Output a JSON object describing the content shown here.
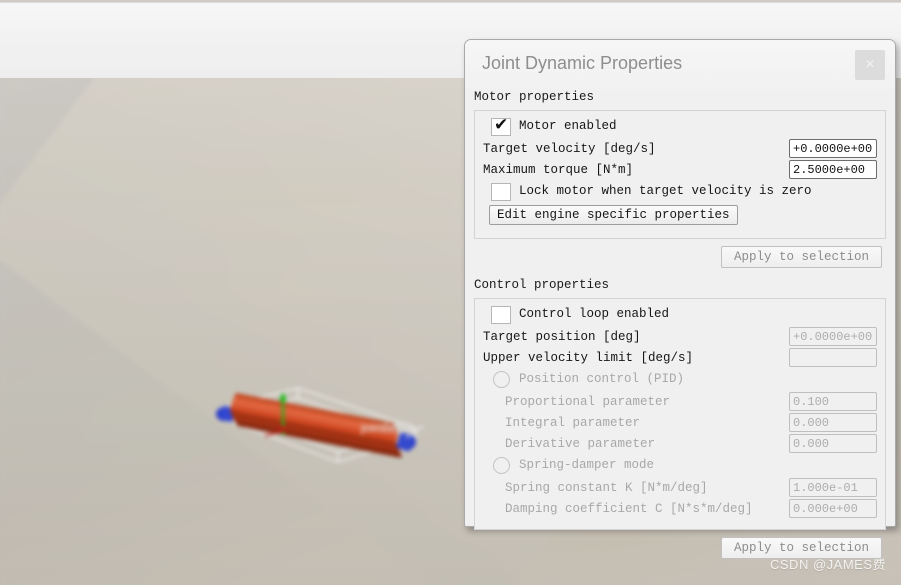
{
  "app": {
    "watermark": "CSDN @JAMES费"
  },
  "viewport": {
    "object_label": "jointleft0"
  },
  "dialog": {
    "title": "Joint Dynamic Properties",
    "close_label": "×",
    "motor": {
      "section_title": "Motor properties",
      "enabled_label": "Motor enabled",
      "enabled_checked": "✔",
      "target_velocity_label": "Target velocity [deg/s]",
      "target_velocity_value": "+0.0000e+00",
      "max_torque_label": "Maximum torque [N*m]",
      "max_torque_value": "2.5000e+00",
      "lock_motor_label": "Lock motor when target velocity is zero",
      "edit_engine_button": "Edit engine specific properties",
      "apply_button": "Apply to selection"
    },
    "control": {
      "section_title": "Control properties",
      "loop_enabled_label": "Control loop enabled",
      "target_position_label": "Target position [deg]",
      "target_position_value": "+0.0000e+00",
      "upper_velocity_label": "Upper velocity limit [deg/s]",
      "upper_velocity_value": "",
      "position_control_label": "Position control (PID)",
      "proportional_label": "Proportional parameter",
      "proportional_value": "0.100",
      "integral_label": "Integral parameter",
      "integral_value": "0.000",
      "derivative_label": "Derivative parameter",
      "derivative_value": "0.000",
      "spring_damper_label": "Spring-damper mode",
      "spring_constant_label": "Spring constant K [N*m/deg]",
      "spring_constant_value": "1.000e-01",
      "damping_label": "Damping coefficient C [N*s*m/deg]",
      "damping_value": "0.000e+00",
      "apply_button": "Apply to selection"
    }
  }
}
